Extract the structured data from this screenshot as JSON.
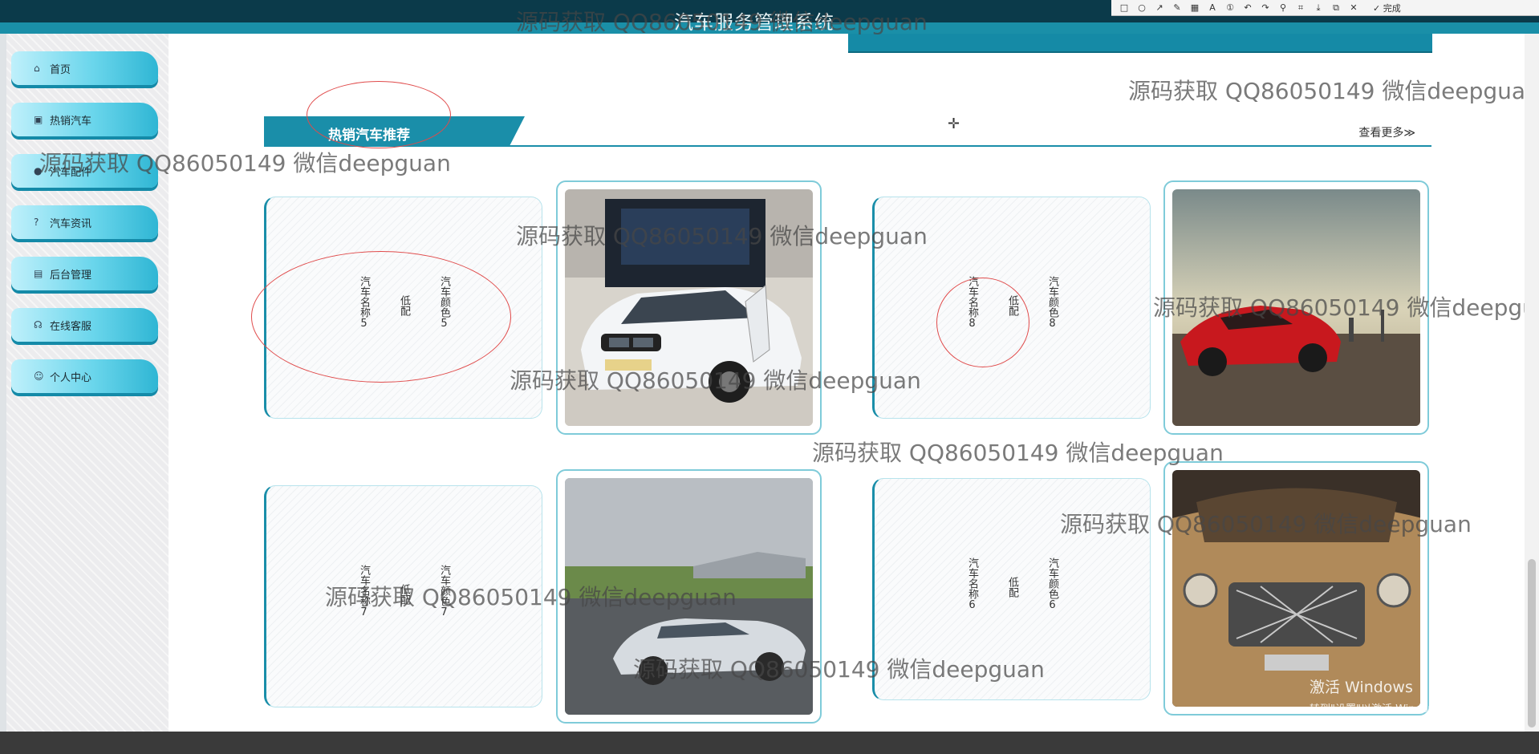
{
  "window": {
    "title": "汽车服务管理系统"
  },
  "capture_toolbar": {
    "icons": [
      "rect-tool-icon",
      "ellipse-tool-icon",
      "arrow-tool-icon",
      "pen-tool-icon",
      "mosaic-tool-icon",
      "text-tool-icon",
      "number-tool-icon",
      "undo-icon",
      "redo-icon",
      "pin-icon",
      "crop-icon",
      "save-icon",
      "copy-icon",
      "cancel-icon"
    ],
    "done_label": "✓ 完成"
  },
  "sidebar": {
    "items": [
      {
        "label": "首页",
        "icon": "home-icon",
        "glyph": "⌂"
      },
      {
        "label": "热销汽车",
        "icon": "bag-icon",
        "glyph": "▣"
      },
      {
        "label": "汽车配件",
        "icon": "dot-icon",
        "glyph": "●"
      },
      {
        "label": "汽车资讯",
        "icon": "help-icon",
        "glyph": "?"
      },
      {
        "label": "后台管理",
        "icon": "calendar-icon",
        "glyph": "▤"
      },
      {
        "label": "在线客服",
        "icon": "headset-icon",
        "glyph": "☊"
      },
      {
        "label": "个人中心",
        "icon": "user-icon",
        "glyph": "☺"
      }
    ]
  },
  "section": {
    "title": "热销汽车推荐",
    "more_label": "查看更多≫"
  },
  "cards": [
    {
      "name_text": "汽车名称5",
      "config": "低配",
      "color_text": "汽车颜色5"
    },
    {
      "name_text": "汽车名称8",
      "config": "低配",
      "color_text": "汽车颜色8"
    },
    {
      "name_text": "汽车名称7",
      "config": "低配",
      "color_text": "汽车颜色7"
    },
    {
      "name_text": "汽车名称6",
      "config": "低配",
      "color_text": "汽车颜色6"
    }
  ],
  "watermark": "源码获取 QQ86050149 微信deepguan",
  "activation": {
    "line1": "激活 Windows",
    "line2": "转到\"设置\"以激活 Windows。"
  }
}
